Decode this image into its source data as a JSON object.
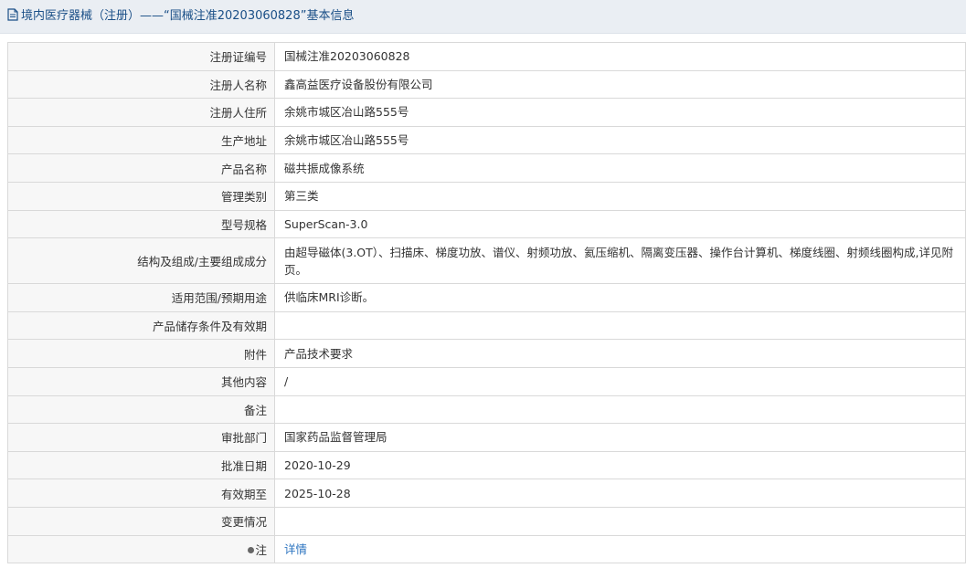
{
  "header": {
    "title": "境内医疗器械（注册）——“国械注准20203060828”基本信息",
    "icon": "document-icon"
  },
  "rows": [
    {
      "label": "注册证编号",
      "value": "国械注准20203060828"
    },
    {
      "label": "注册人名称",
      "value": "鑫高益医疗设备股份有限公司"
    },
    {
      "label": "注册人住所",
      "value": "余姚市城区冶山路555号"
    },
    {
      "label": "生产地址",
      "value": "余姚市城区冶山路555号"
    },
    {
      "label": "产品名称",
      "value": "磁共振成像系统"
    },
    {
      "label": "管理类别",
      "value": "第三类"
    },
    {
      "label": "型号规格",
      "value": "SuperScan-3.0"
    },
    {
      "label": "结构及组成/主要组成成分",
      "value": "由超导磁体(3.OT）、扫描床、梯度功放、谱仪、射频功放、氦压缩机、隔离变压器、操作台计算机、梯度线圈、射频线圈构成,详见附页。"
    },
    {
      "label": "适用范围/预期用途",
      "value": "供临床MRI诊断。"
    },
    {
      "label": "产品储存条件及有效期",
      "value": ""
    },
    {
      "label": "附件",
      "value": "产品技术要求"
    },
    {
      "label": "其他内容",
      "value": "/"
    },
    {
      "label": "备注",
      "value": ""
    },
    {
      "label": "审批部门",
      "value": "国家药品监督管理局"
    },
    {
      "label": "批准日期",
      "value": "2020-10-29"
    },
    {
      "label": "有效期至",
      "value": "2025-10-28"
    },
    {
      "label": "变更情况",
      "value": ""
    },
    {
      "label": "注",
      "value": "详情",
      "icon": "bullet-icon"
    }
  ]
}
